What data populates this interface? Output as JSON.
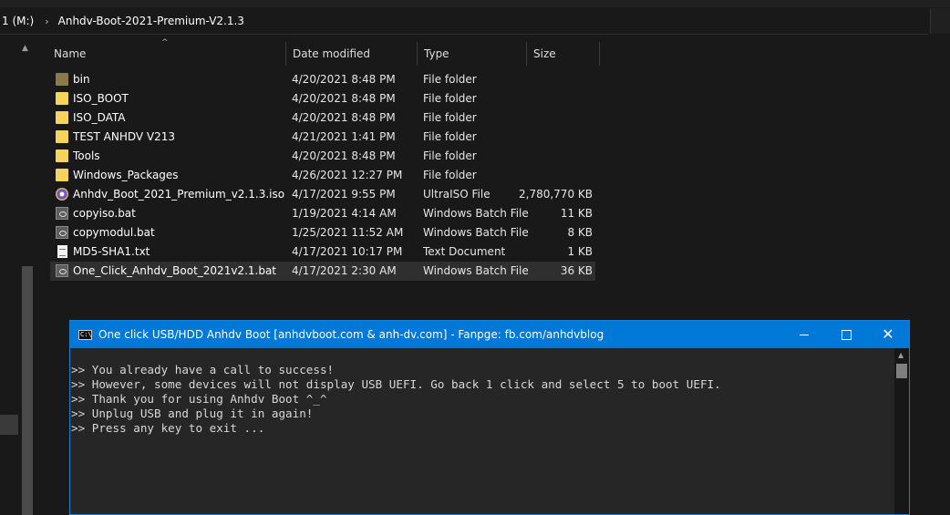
{
  "address_bar": {
    "drive": "1 (M:)",
    "separator": "›",
    "folder": "Anhdv-Boot-2021-Premium-V2.1.3"
  },
  "columns": {
    "name": "Name",
    "date": "Date modified",
    "type": "Type",
    "size": "Size"
  },
  "files": [
    {
      "name": "bin",
      "date": "4/20/2021 8:48 PM",
      "type": "File folder",
      "size": "",
      "icon": "folder-icon"
    },
    {
      "name": "ISO_BOOT",
      "date": "4/20/2021 8:48 PM",
      "type": "File folder",
      "size": "",
      "icon": "folder-icon"
    },
    {
      "name": "ISO_DATA",
      "date": "4/20/2021 8:48 PM",
      "type": "File folder",
      "size": "",
      "icon": "folder-icon"
    },
    {
      "name": "TEST ANHDV V213",
      "date": "4/21/2021 1:41 PM",
      "type": "File folder",
      "size": "",
      "icon": "folder-icon"
    },
    {
      "name": "Tools",
      "date": "4/20/2021 8:48 PM",
      "type": "File folder",
      "size": "",
      "icon": "folder-icon"
    },
    {
      "name": "Windows_Packages",
      "date": "4/26/2021 12:27 PM",
      "type": "File folder",
      "size": "",
      "icon": "folder-icon"
    },
    {
      "name": "Anhdv_Boot_2021_Premium_v2.1.3.iso",
      "date": "4/17/2021 9:55 PM",
      "type": "UltraISO File",
      "size": "2,780,770 KB",
      "icon": "iso-disc-icon"
    },
    {
      "name": "copyiso.bat",
      "date": "1/19/2021 4:14 AM",
      "type": "Windows Batch File",
      "size": "11 KB",
      "icon": "batch-file-icon"
    },
    {
      "name": "copymodul.bat",
      "date": "1/25/2021 11:52 AM",
      "type": "Windows Batch File",
      "size": "8 KB",
      "icon": "batch-file-icon"
    },
    {
      "name": "MD5-SHA1.txt",
      "date": "4/17/2021 10:17 PM",
      "type": "Text Document",
      "size": "1 KB",
      "icon": "text-file-icon"
    },
    {
      "name": "One_Click_Anhdv_Boot_2021v2.1.bat",
      "date": "4/17/2021 2:30 AM",
      "type": "Windows Batch File",
      "size": "36 KB",
      "icon": "batch-file-icon",
      "selected": true
    }
  ],
  "console": {
    "icon_text": "C:\\",
    "title": "One click USB/HDD Anhdv Boot [anhdvboot.com & anh-dv.com] -  Fanpge: fb.com/anhdvblog",
    "close_glyph": "✕",
    "lines": [
      ">> You already have a call to success!",
      ">> However, some devices will not display USB UEFI. Go back 1 click and select 5 to boot UEFI.",
      ">> Thank you for using Anhdv Boot ^_^",
      ">> Unplug USB and plug it in again!",
      ">> Press any key to exit ..."
    ]
  },
  "colors": {
    "background": "#191919",
    "console_titlebar": "#0078d7",
    "console_body": "#262626",
    "folder": "#f6d35a"
  }
}
